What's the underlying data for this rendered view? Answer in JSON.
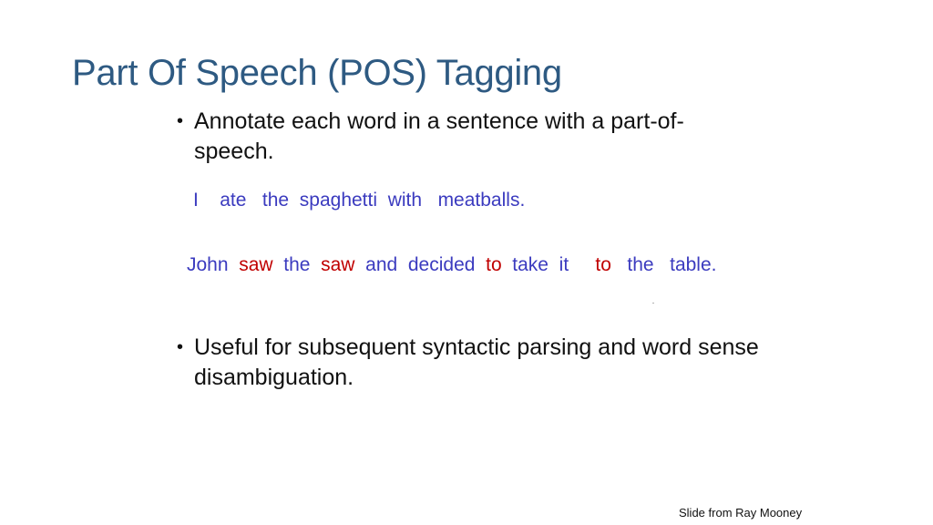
{
  "slide": {
    "title": "Part Of Speech (POS) Tagging",
    "bullets": [
      {
        "marker": "•",
        "text": "Annotate each word in a sentence with a part-of-speech."
      },
      {
        "marker": "•",
        "text": "Useful for subsequent syntactic parsing and word sense disambiguation."
      }
    ],
    "example_sentences": [
      {
        "words": [
          {
            "text": "I",
            "color": "#3b3bbf",
            "gap": "    "
          },
          {
            "text": "ate",
            "color": "#3b3bbf",
            "gap": "   "
          },
          {
            "text": "the",
            "color": "#3b3bbf",
            "gap": "  "
          },
          {
            "text": "spaghetti",
            "color": "#3b3bbf",
            "gap": "  "
          },
          {
            "text": "with",
            "color": "#3b3bbf",
            "gap": "   "
          },
          {
            "text": "meatballs.",
            "color": "#3b3bbf",
            "gap": ""
          }
        ]
      },
      {
        "words": [
          {
            "text": "John",
            "color": "#3b3bbf",
            "gap": "  "
          },
          {
            "text": "saw",
            "color": "#c00000",
            "gap": "  "
          },
          {
            "text": "the",
            "color": "#3b3bbf",
            "gap": "  "
          },
          {
            "text": "saw",
            "color": "#c00000",
            "gap": "  "
          },
          {
            "text": "and",
            "color": "#3b3bbf",
            "gap": "  "
          },
          {
            "text": "decided",
            "color": "#3b3bbf",
            "gap": "  "
          },
          {
            "text": "to",
            "color": "#c00000",
            "gap": "  "
          },
          {
            "text": "take",
            "color": "#3b3bbf",
            "gap": "  "
          },
          {
            "text": "it",
            "color": "#3b3bbf",
            "gap": "     "
          },
          {
            "text": "to",
            "color": "#c00000",
            "gap": "   "
          },
          {
            "text": "the",
            "color": "#3b3bbf",
            "gap": "   "
          },
          {
            "text": "table.",
            "color": "#3b3bbf",
            "gap": ""
          }
        ]
      }
    ],
    "credit": "Slide from Ray Mooney",
    "colors": {
      "title": "#2e5a82",
      "body_text": "#111111",
      "highlight_word": "#c00000",
      "normal_word": "#3b3bbf"
    }
  }
}
